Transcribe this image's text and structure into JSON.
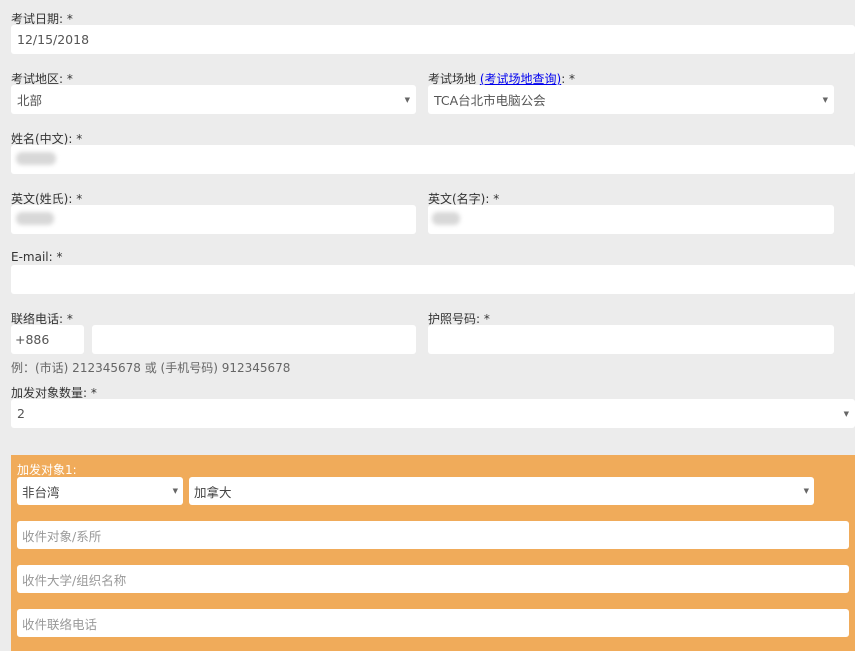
{
  "form": {
    "exam_date": {
      "label": "考试日期: *",
      "value": "12/15/2018"
    },
    "exam_region": {
      "label": "考试地区: *",
      "value": "北部"
    },
    "exam_site": {
      "label_prefix": "考试场地 ",
      "link": "(考试场地查询)",
      "label_suffix": ": *",
      "value": "TCA台北市电脑公会"
    },
    "name_cn": {
      "label": "姓名(中文): *"
    },
    "en_surname": {
      "label": "英文(姓氏): *"
    },
    "en_given": {
      "label": "英文(名字): *"
    },
    "email": {
      "label": "E-mail: *"
    },
    "phone": {
      "label": "联络电话: *",
      "country_code": "+886",
      "hint": "例：(市话) 212345678 或 (手机号码) 912345678"
    },
    "passport": {
      "label": "护照号码: *"
    },
    "copies": {
      "label": "加发对象数量: *",
      "value": "2"
    }
  },
  "recipient": {
    "title": "加发对象1:",
    "location_type": "非台湾",
    "country": "加拿大",
    "target_placeholder": "收件对象/系所",
    "university_placeholder": "收件大学/组织名称",
    "phone_placeholder": "收件联络电话"
  }
}
